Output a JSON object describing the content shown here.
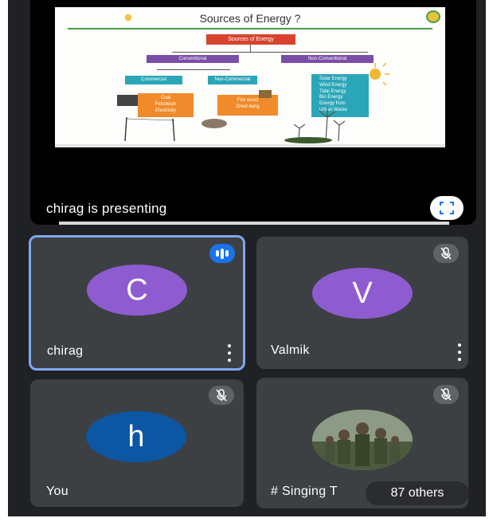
{
  "presentation": {
    "presenter_text": "chirag is presenting",
    "fullscreen_icon": "fullscreen-icon",
    "slide": {
      "title": "Sources of Energy ?",
      "root": "Sources of Energy",
      "conventional": "Conventional",
      "non_conventional": "Non-Conventional",
      "commercial": "Commercial",
      "non_commercial": "Non-Commercial",
      "commercial_items": [
        "Coal",
        "Petroleum",
        "Electricity"
      ],
      "non_commercial_items": [
        "Fire wood",
        "Dried dung"
      ],
      "non_conventional_items": [
        "Solar Energy",
        "Wind Energy",
        "Tidal Energy",
        "Bio Energy",
        "Energy from",
        "Urban Waste"
      ]
    }
  },
  "participants": [
    {
      "name": "chirag",
      "initial": "C",
      "avatar_color": "#8f5bd0",
      "state": "speaking",
      "active": true
    },
    {
      "name": "Valmik",
      "initial": "V",
      "avatar_color": "#8f5bd0",
      "state": "muted"
    },
    {
      "name": "You",
      "initial": "h",
      "avatar_color": "#0b57a4",
      "state": "muted"
    },
    {
      "name": "# Singing T",
      "state": "muted",
      "avatar": "photo"
    }
  ],
  "others_pill": "87 others",
  "colors": {
    "background": "#202124",
    "tile": "#3c4043",
    "active_border": "#7fa7ef",
    "speaking": "#1a73e8"
  }
}
